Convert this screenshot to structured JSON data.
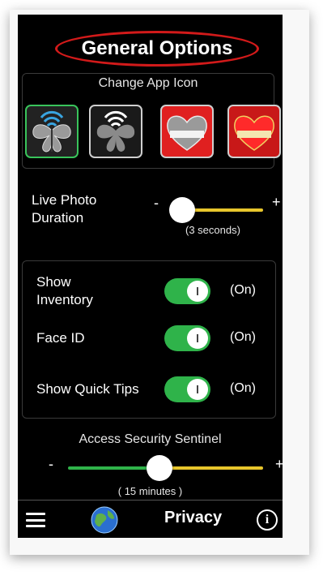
{
  "header": {
    "title": "General Options"
  },
  "app_icon_section": {
    "label": "Change App Icon",
    "icons": [
      {
        "name": "butterfly-wifi-icon",
        "selected": true
      },
      {
        "name": "butterfly-silhouette-icon",
        "selected": false
      },
      {
        "name": "heart-return-to-me-icon",
        "selected": false,
        "text": "Return to Me"
      },
      {
        "name": "heart-return-to-me-red-icon",
        "selected": false,
        "text": "Return to Me"
      }
    ]
  },
  "live_photo": {
    "label_line1": "Live Photo",
    "label_line2": "Duration",
    "minus": "-",
    "plus": "+",
    "value_text": "(3 seconds)",
    "level": 0.0
  },
  "toggles": [
    {
      "label_line1": "Show",
      "label_line2": "Inventory",
      "value": "(On)",
      "on": true
    },
    {
      "label_line1": "Face ID",
      "label_line2": "",
      "value": "(On)",
      "on": true
    },
    {
      "label_line1": "Show Quick Tips",
      "label_line2": "",
      "value": "(On)",
      "on": true
    }
  ],
  "sentinel": {
    "label": "Access Security Sentinel",
    "minus": "-",
    "plus": "+",
    "value_text": "( 15 minutes )",
    "level": 0.47
  },
  "bottom_bar": {
    "title": "Privacy",
    "info_glyph": "i"
  },
  "colors": {
    "accent_green": "#2fb34a",
    "slider_yellow": "#e8c62c",
    "title_ring_red": "#d21a1a",
    "background": "#000000"
  }
}
